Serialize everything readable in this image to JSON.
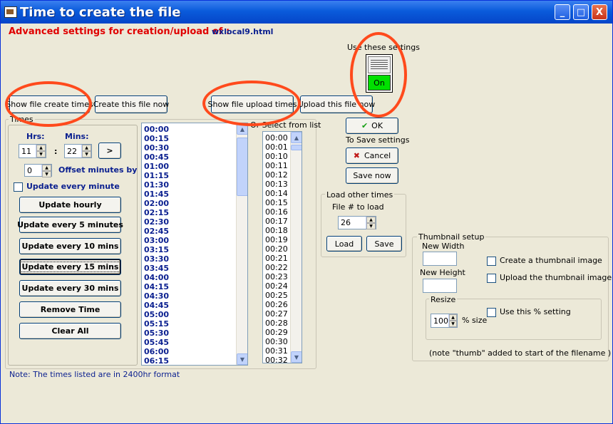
{
  "window": {
    "title": "Time to create the file",
    "buttons": {
      "minimize": "_",
      "maximize": "□",
      "close": "X"
    }
  },
  "header": {
    "label": "Advanced settings for creation/upload of :",
    "filename": "wxlocal9.html"
  },
  "use_settings": {
    "label": "Use these settings",
    "toggle_state": "On"
  },
  "top_buttons": {
    "show_create_times": "Show file create times",
    "create_now": "Create this file now",
    "show_upload_times": "Show file upload times",
    "upload_now": "Upload this file now"
  },
  "times_group": {
    "label": "Times",
    "hrs_label": "Hrs:",
    "mins_label": "Mins:",
    "hrs_value": "11",
    "colon": ":",
    "mins_value": "22",
    "add_button": ">",
    "offset_value": "0",
    "offset_label": "Offset minutes by",
    "update_minute_label": "Update every minute",
    "buttons": [
      "Update hourly",
      "Update every 5 minutes",
      "Update every 10 mins",
      "Update every 15 mins",
      "Update every 30 mins",
      "Remove Time",
      "Clear All"
    ]
  },
  "times_list": [
    "00:00",
    "00:15",
    "00:30",
    "00:45",
    "01:00",
    "01:15",
    "01:30",
    "01:45",
    "02:00",
    "02:15",
    "02:30",
    "02:45",
    "03:00",
    "03:15",
    "03:30",
    "03:45",
    "04:00",
    "04:15",
    "04:30",
    "04:45",
    "05:00",
    "05:15",
    "05:30",
    "05:45",
    "06:00",
    "06:15"
  ],
  "select_list": {
    "label": "Or Select from list",
    "items": [
      "00:00",
      "00:01",
      "00:10",
      "00:11",
      "00:12",
      "00:13",
      "00:14",
      "00:15",
      "00:16",
      "00:17",
      "00:18",
      "00:19",
      "00:20",
      "00:21",
      "00:22",
      "00:23",
      "00:24",
      "00:25",
      "00:26",
      "00:27",
      "00:28",
      "00:29",
      "00:30",
      "00:31",
      "00:32"
    ]
  },
  "actions": {
    "ok": "OK",
    "save_settings_label": "To Save settings",
    "cancel": "Cancel",
    "save_now": "Save now"
  },
  "load_group": {
    "label": "Load other times",
    "file_label": "File # to load",
    "file_value": "26",
    "load": "Load",
    "save": "Save"
  },
  "thumb_group": {
    "label": "Thumbnail setup",
    "new_width": "New Width",
    "new_height": "New Height",
    "create_thumb": "Create a thumbnail image",
    "upload_thumb": "Upload the thumbnail image",
    "resize_label": "Resize",
    "resize_value": "100",
    "size_label": "% size",
    "use_percent": "Use this % setting",
    "note": "(note \"thumb\" added to start of the filename )"
  },
  "footer_note": "Note: The times listed are in 2400hr format",
  "colors": {
    "accent_red": "#e00000",
    "accent_blue": "#0a1f8f",
    "toggle_green": "#00e000",
    "annotation": "#ff4a1c"
  }
}
